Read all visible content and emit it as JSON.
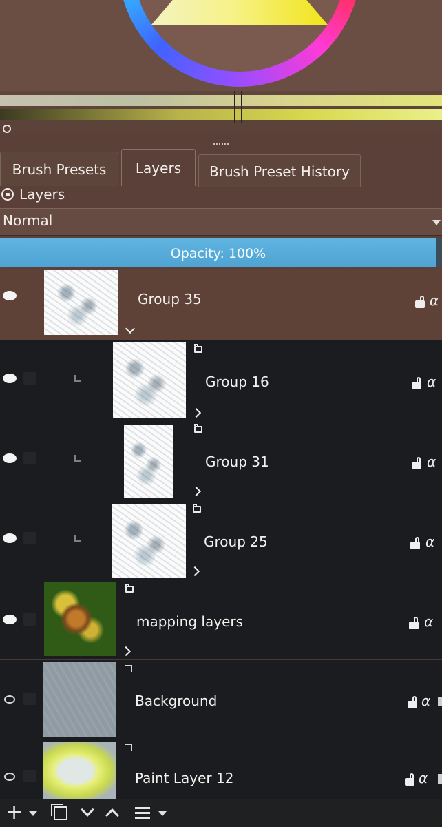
{
  "colors": {
    "panel_bg": "#5a4038",
    "opacity_bar": "#4ea3d2",
    "selected_row": "#5e4237",
    "dark_row": "#1b1c1f"
  },
  "tabs": [
    {
      "label": "Brush Presets",
      "active": false
    },
    {
      "label": "Layers",
      "active": true
    },
    {
      "label": "Brush Preset History",
      "active": false
    }
  ],
  "panel": {
    "title": "Layers"
  },
  "blend_mode": {
    "value": "Normal"
  },
  "opacity": {
    "label": "Opacity:",
    "value": "100%"
  },
  "layers": [
    {
      "name": "Group 35",
      "visible": true,
      "selected": true,
      "expanded": true,
      "icon": "chevron-down-icon"
    },
    {
      "name": "Group 16",
      "visible": true,
      "child": true,
      "icon": "folder-icon"
    },
    {
      "name": "Group 31",
      "visible": true,
      "child": true,
      "icon": "folder-icon"
    },
    {
      "name": "Group 25",
      "visible": true,
      "child": true,
      "icon": "folder-icon"
    },
    {
      "name": "mapping layers",
      "visible": true,
      "icon": "folder-icon"
    },
    {
      "name": "Background",
      "visible": false,
      "icon": "link-icon"
    },
    {
      "name": "Paint Layer 12",
      "visible": false,
      "icon": "link-icon"
    }
  ],
  "layer_row_icons": {
    "alpha": "α",
    "lock": "lock-icon"
  },
  "toolbar": {
    "add": "+",
    "items": [
      "add-layer-icon",
      "duplicate-layer-icon",
      "move-down-icon",
      "move-up-icon",
      "layer-properties-icon"
    ]
  }
}
